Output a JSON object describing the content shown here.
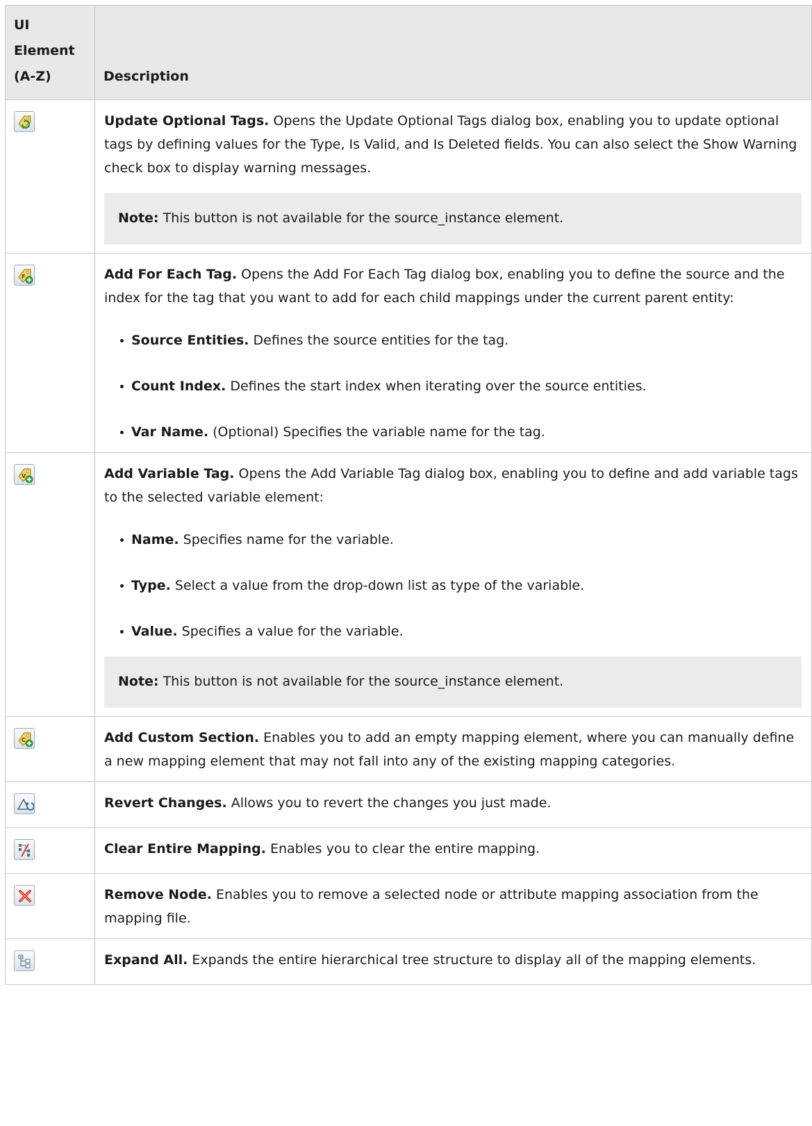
{
  "table": {
    "header": {
      "col1": "UI Element (A-Z)",
      "col1_line1": "UI",
      "col1_line2": "Element",
      "col1_line3": "(A-Z)",
      "col2": "Description"
    },
    "rows": [
      {
        "icon": "update-optional-tags-icon",
        "title": "Update Optional Tags.",
        "text": " Opens the Update Optional Tags dialog box, enabling you to update optional tags by defining values for the Type, Is Valid, and Is Deleted fields. You can also select the Show Warning check box to display warning messages.",
        "note_label": "Note:",
        "note_text": " This button is not available for the source_instance element."
      },
      {
        "icon": "add-for-each-tag-icon",
        "title": "Add For Each Tag.",
        "text": " Opens the Add For Each Tag dialog box, enabling you to define the source and the index for the tag that you want to add for each child mappings under the current parent entity:",
        "bullets": [
          {
            "title": "Source Entities.",
            "text": " Defines the source entities for the tag."
          },
          {
            "title": "Count Index.",
            "text": " Defines the start index when iterating over the source entities."
          },
          {
            "title": "Var Name.",
            "text": " (Optional) Specifies the variable name for the tag."
          }
        ]
      },
      {
        "icon": "add-variable-tag-icon",
        "title": "Add Variable Tag.",
        "text": " Opens the Add Variable Tag dialog box, enabling you to define and add variable tags to the selected variable element:",
        "bullets": [
          {
            "title": "Name.",
            "text": " Specifies name for the variable."
          },
          {
            "title": "Type.",
            "text": " Select a value from the drop-down list as type of the variable."
          },
          {
            "title": "Value.",
            "text": " Specifies a value for the variable."
          }
        ],
        "note_label": "Note:",
        "note_text": " This button is not available for the source_instance element."
      },
      {
        "icon": "add-custom-section-icon",
        "title": "Add Custom Section.",
        "text": " Enables you to add an empty mapping element, where you can manually define a new mapping element that may not fall into any of the existing mapping categories."
      },
      {
        "icon": "revert-changes-icon",
        "title": "Revert Changes.",
        "text": " Allows you to revert the changes you just made."
      },
      {
        "icon": "clear-entire-mapping-icon",
        "title": "Clear Entire Mapping.",
        "text": " Enables you to clear the entire mapping."
      },
      {
        "icon": "remove-node-icon",
        "title": "Remove Node.",
        "text": " Enables you to remove a selected node or attribute mapping association from the mapping file."
      },
      {
        "icon": "expand-all-icon",
        "title": "Expand All.",
        "text": " Expands the entire hierarchical tree structure to display all of the mapping elements."
      }
    ]
  },
  "colors": {
    "header_bg": "#e8e8e8",
    "note_bg": "#ebebeb",
    "border": "#c8c8c8",
    "tag_icon_yellow": "#f2d46a",
    "tag_icon_green": "#3aa64a",
    "remove_red": "#e0392b"
  }
}
